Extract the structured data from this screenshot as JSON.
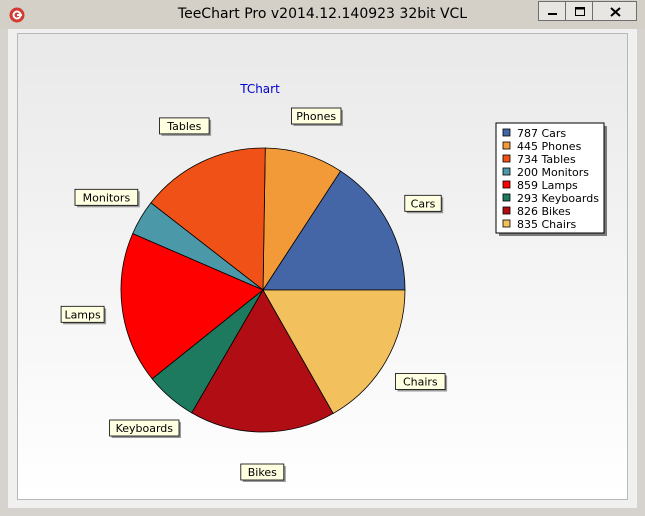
{
  "window": {
    "title": "TeeChart Pro v2014.12.140923 32bit VCL"
  },
  "icons": {
    "app": "teechart-app-icon",
    "minimize": "minimize-icon",
    "maximize": "maximize-icon",
    "close": "close-icon"
  },
  "chart_data": {
    "type": "pie",
    "title": "TChart",
    "categories": [
      "Cars",
      "Phones",
      "Tables",
      "Monitors",
      "Lamps",
      "Keyboards",
      "Bikes",
      "Chairs"
    ],
    "values": [
      787,
      445,
      734,
      200,
      859,
      293,
      826,
      835
    ],
    "colors": [
      "#4466a6",
      "#f29a38",
      "#f05116",
      "#4a98a8",
      "#fe0000",
      "#1d7a5e",
      "#b00e14",
      "#f3c05e"
    ],
    "legend_entries": [
      "787 Cars",
      "445 Phones",
      "734 Tables",
      "200 Monitors",
      "859 Lamps",
      "293 Keyboards",
      "826 Bikes",
      "835 Chairs"
    ],
    "legend_position": "top-right"
  }
}
